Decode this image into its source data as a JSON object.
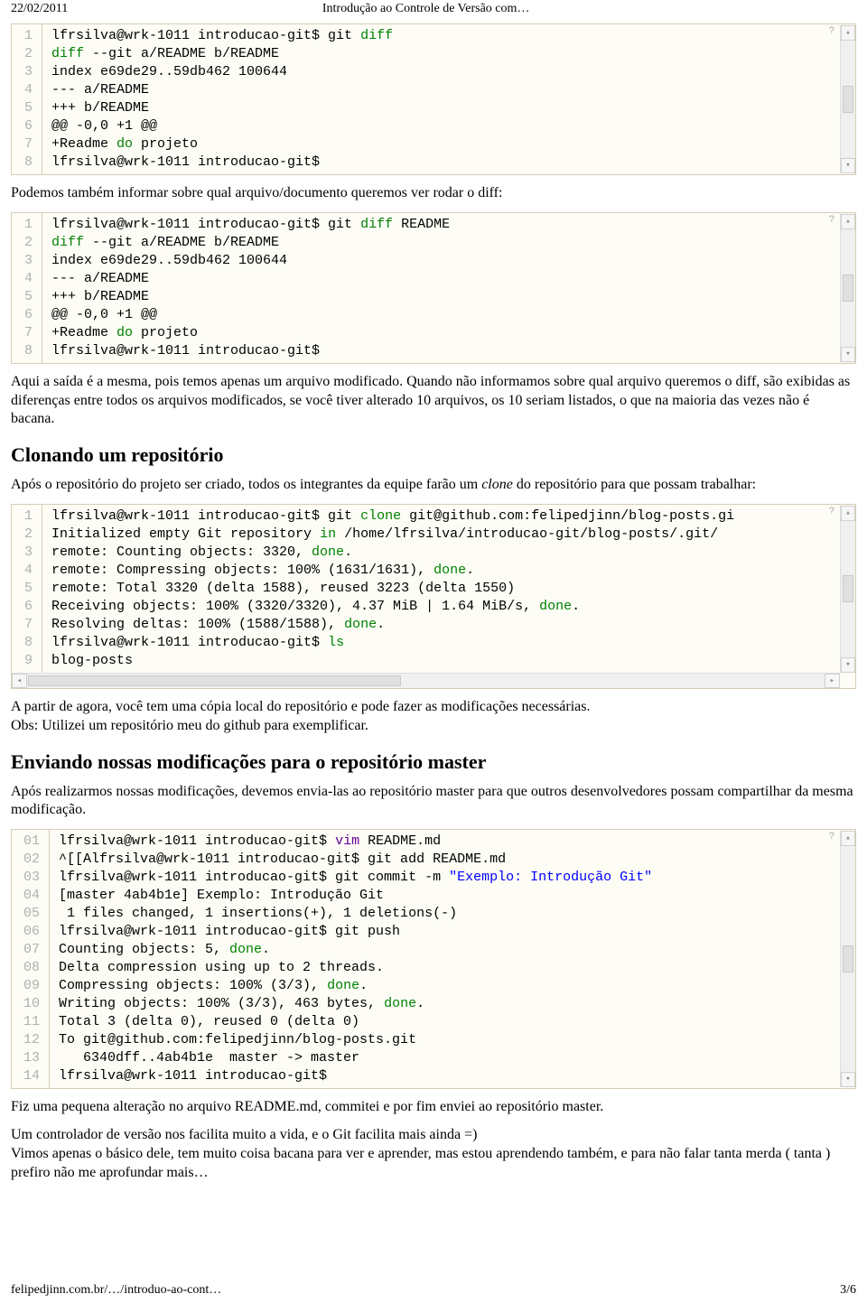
{
  "header": {
    "date": "22/02/2011",
    "title": "Introdução ao Controle de Versão com…"
  },
  "footer": {
    "url": "felipedjinn.com.br/…/introduo-ao-cont…",
    "page": "3/6"
  },
  "code1": {
    "nums": [
      "1",
      "2",
      "3",
      "4",
      "5",
      "6",
      "7",
      "8"
    ],
    "lines": [
      [
        {
          "t": "lfrsilva@wrk-1011 introducao-git$ git ",
          "c": "txt"
        },
        {
          "t": "diff",
          "c": "kw"
        }
      ],
      [
        {
          "t": "diff",
          "c": "kw"
        },
        {
          "t": " --git a/README b/README",
          "c": "txt"
        }
      ],
      [
        {
          "t": "index e69de29..59db462 100644",
          "c": "txt"
        }
      ],
      [
        {
          "t": "--- a/README",
          "c": "txt"
        }
      ],
      [
        {
          "t": "+++ b/README",
          "c": "txt"
        }
      ],
      [
        {
          "t": "@@ -0,0 +1 @@",
          "c": "txt"
        }
      ],
      [
        {
          "t": "+Readme ",
          "c": "txt"
        },
        {
          "t": "do",
          "c": "kw"
        },
        {
          "t": " projeto",
          "c": "txt"
        }
      ],
      [
        {
          "t": "lfrsilva@wrk-1011 introducao-git$",
          "c": "txt"
        }
      ]
    ]
  },
  "p1": "Podemos também informar sobre qual arquivo/documento queremos ver rodar o diff:",
  "code2": {
    "nums": [
      "1",
      "2",
      "3",
      "4",
      "5",
      "6",
      "7",
      "8"
    ],
    "lines": [
      [
        {
          "t": "lfrsilva@wrk-1011 introducao-git$ git ",
          "c": "txt"
        },
        {
          "t": "diff",
          "c": "kw"
        },
        {
          "t": " README",
          "c": "txt"
        }
      ],
      [
        {
          "t": "diff",
          "c": "kw"
        },
        {
          "t": " --git a/README b/README",
          "c": "txt"
        }
      ],
      [
        {
          "t": "index e69de29..59db462 100644",
          "c": "txt"
        }
      ],
      [
        {
          "t": "--- a/README",
          "c": "txt"
        }
      ],
      [
        {
          "t": "+++ b/README",
          "c": "txt"
        }
      ],
      [
        {
          "t": "@@ -0,0 +1 @@",
          "c": "txt"
        }
      ],
      [
        {
          "t": "+Readme ",
          "c": "txt"
        },
        {
          "t": "do",
          "c": "kw"
        },
        {
          "t": " projeto",
          "c": "txt"
        }
      ],
      [
        {
          "t": "lfrsilva@wrk-1011 introducao-git$",
          "c": "txt"
        }
      ]
    ]
  },
  "p2": "Aqui a saída é a mesma, pois temos apenas um arquivo modificado. Quando não informamos sobre qual arquivo queremos o diff, são exibidas as diferenças entre todos os arquivos modificados, se você tiver alterado 10 arquivos, os 10 seriam listados, o que na maioria das vezes não é bacana.",
  "h1": "Clonando um repositório",
  "p3_a": "Após o repositório do projeto ser criado, todos os integrantes da equipe farão um ",
  "p3_em": "clone",
  "p3_b": " do repositório para que possam trabalhar:",
  "code3": {
    "nums": [
      "1",
      "2",
      "3",
      "4",
      "5",
      "6",
      "7",
      "8",
      "9"
    ],
    "lines": [
      [
        {
          "t": "lfrsilva@wrk-1011 introducao-git$ git ",
          "c": "txt"
        },
        {
          "t": "clone",
          "c": "kw"
        },
        {
          "t": " git@github.com:felipedjinn/blog-posts.gi",
          "c": "txt"
        }
      ],
      [
        {
          "t": "Initialized empty Git repository ",
          "c": "txt"
        },
        {
          "t": "in",
          "c": "kw"
        },
        {
          "t": " /home/lfrsilva/introducao-git/blog-posts/.git/",
          "c": "txt"
        }
      ],
      [
        {
          "t": "remote: Counting objects: 3320, ",
          "c": "txt"
        },
        {
          "t": "done",
          "c": "kw"
        },
        {
          "t": ".",
          "c": "txt"
        }
      ],
      [
        {
          "t": "remote: Compressing objects: 100% (1631/1631), ",
          "c": "txt"
        },
        {
          "t": "done",
          "c": "kw"
        },
        {
          "t": ".",
          "c": "txt"
        }
      ],
      [
        {
          "t": "remote: Total 3320 (delta 1588), reused 3223 (delta 1550)",
          "c": "txt"
        }
      ],
      [
        {
          "t": "Receiving objects: 100% (3320/3320), 4.37 MiB | 1.64 MiB/s, ",
          "c": "txt"
        },
        {
          "t": "done",
          "c": "kw"
        },
        {
          "t": ".",
          "c": "txt"
        }
      ],
      [
        {
          "t": "Resolving deltas: 100% (1588/1588), ",
          "c": "txt"
        },
        {
          "t": "done",
          "c": "kw"
        },
        {
          "t": ".",
          "c": "txt"
        }
      ],
      [
        {
          "t": "lfrsilva@wrk-1011 introducao-git$ ",
          "c": "txt"
        },
        {
          "t": "ls",
          "c": "kw"
        }
      ],
      [
        {
          "t": "blog-posts",
          "c": "txt"
        }
      ]
    ]
  },
  "p4a": "A partir de agora, você tem uma cópia local do repositório e pode fazer as modificações necessárias.",
  "p4b": "Obs: Utilizei um repositório meu do github para exemplificar.",
  "h2": "Enviando nossas modificações para o repositório master",
  "p5": "Após realizarmos nossas modificações, devemos envia-las ao repositório master para que outros desenvolvedores possam compartilhar da mesma modificação.",
  "code4": {
    "nums": [
      "01",
      "02",
      "03",
      "04",
      "05",
      "06",
      "07",
      "08",
      "09",
      "10",
      "11",
      "12",
      "13",
      "14"
    ],
    "lines": [
      [
        {
          "t": "lfrsilva@wrk-1011 introducao-git$ ",
          "c": "txt"
        },
        {
          "t": "vim",
          "c": "vi"
        },
        {
          "t": " README.md",
          "c": "txt"
        }
      ],
      [
        {
          "t": "^[[Alfrsilva@wrk-1011 introducao-git$ git add README.md",
          "c": "txt"
        }
      ],
      [
        {
          "t": "lfrsilva@wrk-1011 introducao-git$ git commit -m ",
          "c": "txt"
        },
        {
          "t": "\"Exemplo: Introdução Git\"",
          "c": "str"
        }
      ],
      [
        {
          "t": "[master 4ab4b1e] Exemplo: Introdução Git",
          "c": "txt"
        }
      ],
      [
        {
          "t": " 1 files changed, 1 insertions(+), 1 deletions(-)",
          "c": "txt"
        }
      ],
      [
        {
          "t": "lfrsilva@wrk-1011 introducao-git$ git push",
          "c": "txt"
        }
      ],
      [
        {
          "t": "Counting objects: 5, ",
          "c": "txt"
        },
        {
          "t": "done",
          "c": "kw"
        },
        {
          "t": ".",
          "c": "txt"
        }
      ],
      [
        {
          "t": "Delta compression using up to 2 threads.",
          "c": "txt"
        }
      ],
      [
        {
          "t": "Compressing objects: 100% (3/3), ",
          "c": "txt"
        },
        {
          "t": "done",
          "c": "kw"
        },
        {
          "t": ".",
          "c": "txt"
        }
      ],
      [
        {
          "t": "Writing objects: 100% (3/3), 463 bytes, ",
          "c": "txt"
        },
        {
          "t": "done",
          "c": "kw"
        },
        {
          "t": ".",
          "c": "txt"
        }
      ],
      [
        {
          "t": "Total 3 (delta 0), reused 0 (delta 0)",
          "c": "txt"
        }
      ],
      [
        {
          "t": "To git@github.com:felipedjinn/blog-posts.git",
          "c": "txt"
        }
      ],
      [
        {
          "t": "   6340dff..4ab4b1e  master -> master",
          "c": "txt"
        }
      ],
      [
        {
          "t": "lfrsilva@wrk-1011 introducao-git$",
          "c": "txt"
        }
      ]
    ]
  },
  "p6": "Fiz uma pequena alteração no arquivo README.md, commitei e por fim enviei ao repositório master.",
  "p7a": "Um controlador de versão nos facilita muito a vida, e o Git facilita mais ainda =)",
  "p7b": "Vimos apenas o básico dele, tem muito coisa bacana para ver e aprender, mas estou aprendendo também, e para não falar tanta merda ( tanta ) prefiro não me aprofundar mais…"
}
